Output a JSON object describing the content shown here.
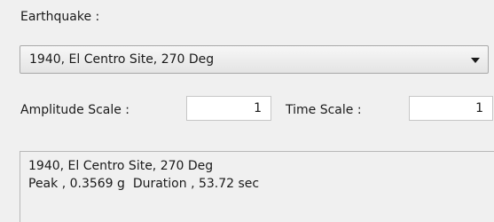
{
  "earthquake": {
    "label": "Earthquake :",
    "selected": "1940, El Centro Site, 270 Deg"
  },
  "amplitude_scale": {
    "label": "Amplitude Scale :",
    "value": "1"
  },
  "time_scale": {
    "label": "Time Scale :",
    "value": "1"
  },
  "info": {
    "line1": "1940, El Centro Site, 270 Deg",
    "line2": "Peak , 0.3569 g  Duration , 53.72 sec"
  },
  "icons": {
    "dropdown": "chevron-down-icon"
  }
}
